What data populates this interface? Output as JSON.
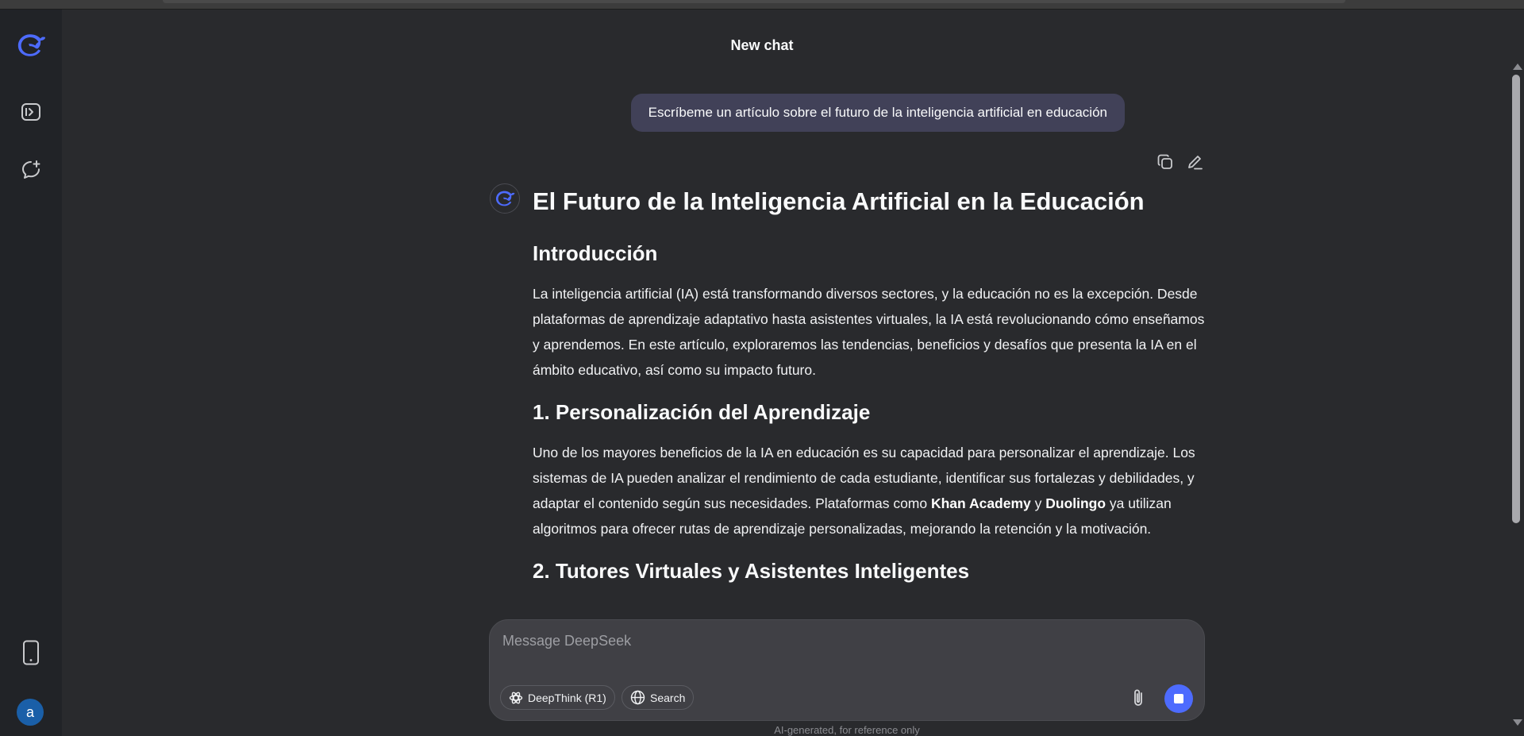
{
  "header": {
    "title": "New chat"
  },
  "sidebar": {
    "items": [
      {
        "name": "logo",
        "icon": "deepseek-whale-icon"
      },
      {
        "name": "open-sidebar",
        "icon": "sidebar-toggle-icon"
      },
      {
        "name": "new-chat",
        "icon": "new-chat-icon"
      },
      {
        "name": "get-app",
        "icon": "phone-icon"
      }
    ],
    "avatar_letter": "a"
  },
  "conversation": {
    "user_message": "Escríbeme un artículo sobre el futuro de la inteligencia artificial en educación",
    "answer": {
      "title": "El Futuro de la Inteligencia Artificial en la Educación",
      "sections": [
        {
          "heading": "Introducción",
          "paragraph": "La inteligencia artificial (IA) está transformando diversos sectores, y la educación no es la excepción. Desde plataformas de aprendizaje adaptativo hasta asistentes virtuales, la IA está revolucionando cómo enseñamos y aprendemos. En este artículo, exploraremos las tendencias, beneficios y desafíos que presenta la IA en el ámbito educativo, así como su impacto futuro."
        },
        {
          "heading": "1. Personalización del Aprendizaje",
          "paragraph_parts": {
            "p1": "Uno de los mayores beneficios de la IA en educación es su capacidad para personalizar el aprendizaje. Los sistemas de IA pueden analizar el rendimiento de cada estudiante, identificar sus fortalezas y debilidades, y adaptar el contenido según sus necesidades. Plataformas como ",
            "b1": "Khan Academy",
            "p2": " y ",
            "b2": "Duolingo",
            "p3": " ya utilizan algoritmos para ofrecer rutas de aprendizaje personalizadas, mejorando la retención y la motivación."
          }
        },
        {
          "heading": "2. Tutores Virtuales y Asistentes Inteligentes"
        }
      ]
    }
  },
  "composer": {
    "placeholder": "Message DeepSeek",
    "deepthink_label": "DeepThink (R1)",
    "search_label": "Search"
  },
  "footer": {
    "disclaimer": "AI-generated, for reference only"
  },
  "colors": {
    "accent": "#4d6bfe",
    "background": "#292a2d",
    "sidebar": "#212327",
    "user_bubble": "#414158"
  }
}
